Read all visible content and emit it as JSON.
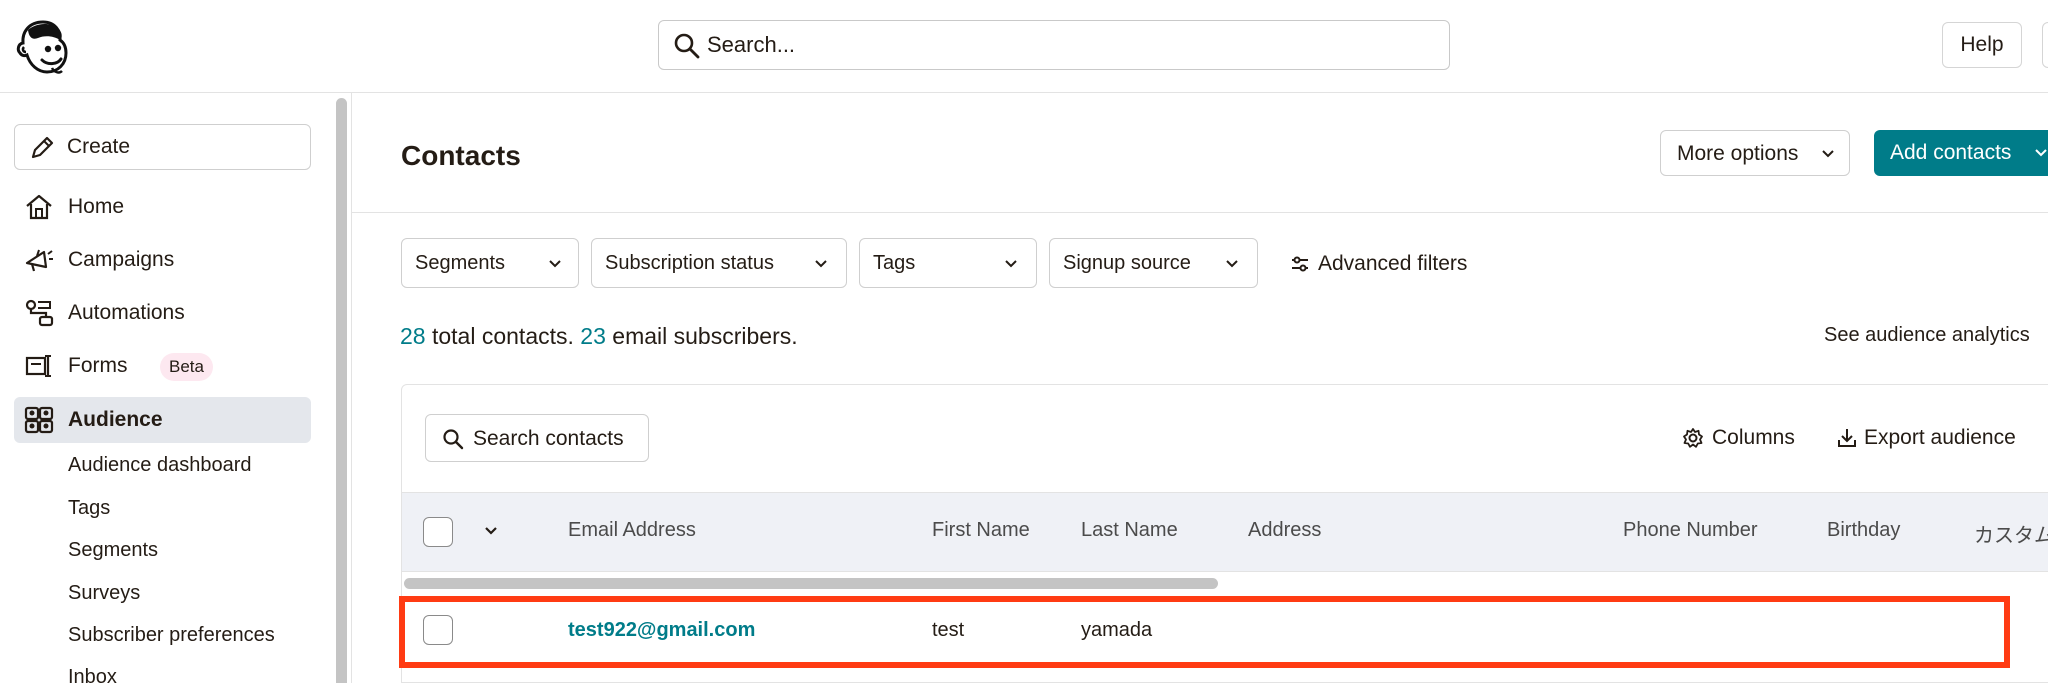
{
  "header": {
    "search_placeholder": "Search...",
    "help_label": "Help"
  },
  "sidebar": {
    "create_label": "Create",
    "items": [
      {
        "label": "Home",
        "icon": "home-icon"
      },
      {
        "label": "Campaigns",
        "icon": "megaphone-icon"
      },
      {
        "label": "Automations",
        "icon": "automation-flow-icon"
      },
      {
        "label": "Forms",
        "icon": "form-icon",
        "badge": "Beta"
      },
      {
        "label": "Audience",
        "icon": "audience-icon",
        "active": true
      }
    ],
    "sub_items": [
      "Audience dashboard",
      "Tags",
      "Segments",
      "Surveys",
      "Subscriber preferences",
      "Inbox"
    ]
  },
  "main": {
    "title": "Contacts",
    "more_options_label": "More options",
    "add_contacts_label": "Add contacts",
    "filters": [
      "Segments",
      "Subscription status",
      "Tags",
      "Signup source"
    ],
    "advanced_filters_label": "Advanced filters",
    "totals": {
      "total_count": "28",
      "total_text": " total contacts. ",
      "email_count": "23",
      "email_text": " email subscribers."
    },
    "see_analytics_label": "See audience analytics",
    "search_contacts_label": "Search contacts",
    "columns_label": "Columns",
    "export_label": "Export audience",
    "table": {
      "headers": [
        "Email Address",
        "First Name",
        "Last Name",
        "Address",
        "Phone Number",
        "Birthday",
        "カスタム"
      ],
      "rows": [
        {
          "email": "test922@gmail.com",
          "first_name": "test",
          "last_name": "yamada",
          "address": "",
          "phone": "",
          "birthday": ""
        }
      ]
    }
  },
  "colors": {
    "accent": "#007c89",
    "highlight": "#ff3b13",
    "active_nav": "#e4e7ec",
    "table_header": "#eff1f6"
  }
}
